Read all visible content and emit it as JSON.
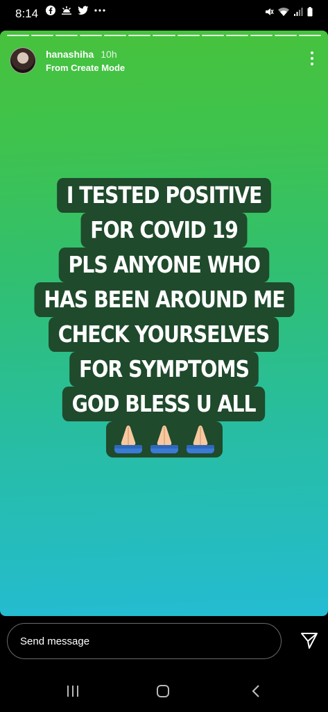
{
  "status_bar": {
    "time": "8:14",
    "left_icons": [
      "facebook-icon",
      "weather-icon",
      "twitter-icon",
      "more-dots-icon"
    ],
    "right_icons": [
      "mute-icon",
      "wifi-icon",
      "signal-icon",
      "battery-icon"
    ]
  },
  "story": {
    "progress_segments": 13,
    "username": "hanashiha",
    "posted_ago": "10h",
    "subtitle": "From Create Mode",
    "caption_lines": [
      "I TESTED POSITIVE",
      "FOR COVID 19",
      "PLS ANYONE WHO",
      "HAS BEEN AROUND ME",
      "CHECK YOURSELVES",
      "FOR  SYMPTOMS",
      "GOD BLESS U ALL"
    ],
    "emoji": [
      "folded-hands-emoji",
      "folded-hands-emoji",
      "folded-hands-emoji"
    ],
    "colors": {
      "gradient_top": "#47c23c",
      "gradient_bottom": "#24bcd2",
      "caption_bg": "#1f4a2c"
    }
  },
  "message_bar": {
    "placeholder": "Send message"
  }
}
